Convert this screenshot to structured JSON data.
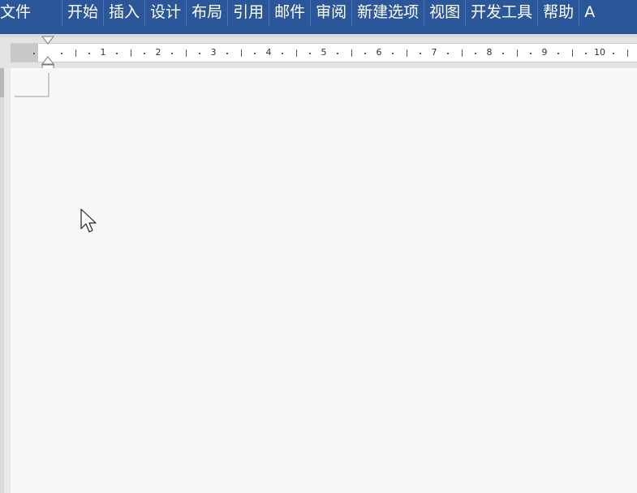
{
  "ribbon": {
    "tabs": [
      {
        "id": "file",
        "label": "文件"
      },
      {
        "id": "home",
        "label": "开始"
      },
      {
        "id": "insert",
        "label": "插入"
      },
      {
        "id": "design",
        "label": "设计"
      },
      {
        "id": "layout",
        "label": "布局"
      },
      {
        "id": "references",
        "label": "引用"
      },
      {
        "id": "mailings",
        "label": "邮件"
      },
      {
        "id": "review",
        "label": "审阅"
      },
      {
        "id": "new-tab",
        "label": "新建选项"
      },
      {
        "id": "view",
        "label": "视图"
      },
      {
        "id": "developer",
        "label": "开发工具"
      },
      {
        "id": "help",
        "label": "帮助"
      },
      {
        "id": "overflow",
        "label": "A"
      }
    ],
    "colors": {
      "background": "#2b579a",
      "text": "#ffffff"
    }
  },
  "ruler": {
    "numbers": [
      "1",
      "2",
      "3",
      "4",
      "5",
      "6",
      "7",
      "8",
      "9",
      "10"
    ]
  },
  "icons": {
    "indent": "indent-marker-icon",
    "cursor": "mouse-pointer-icon"
  }
}
